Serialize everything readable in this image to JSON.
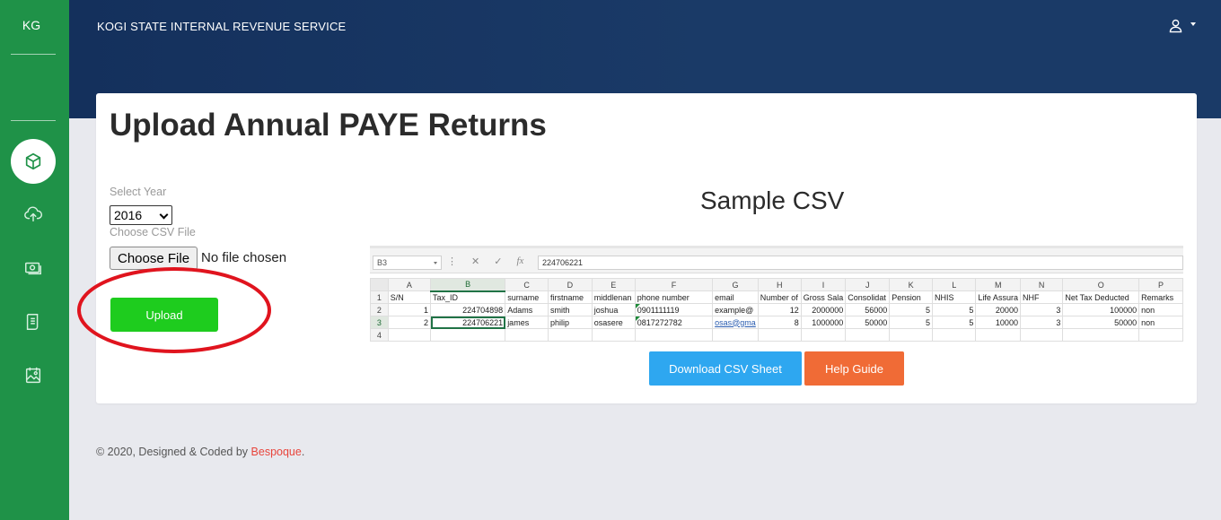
{
  "sidebar": {
    "brand": "KG",
    "items": [
      {
        "icon": "cube-icon",
        "active": true
      },
      {
        "icon": "cloud-upload-icon",
        "active": false
      },
      {
        "icon": "money-icon",
        "active": false
      },
      {
        "icon": "receipt-icon",
        "active": false
      },
      {
        "icon": "image-icon",
        "active": false
      }
    ]
  },
  "header": {
    "title": "KOGI STATE INTERNAL REVENUE SERVICE",
    "user_icon": "user-icon"
  },
  "main": {
    "page_title": "Upload Annual PAYE Returns",
    "select_year_label": "Select Year",
    "year_value": "2016",
    "csv_label": "Choose CSV File",
    "file_button": "Choose File",
    "file_status": "No file chosen",
    "upload_label": "Upload",
    "sample_title": "Sample CSV",
    "download_label": "Download CSV Sheet",
    "help_label": "Help Guide"
  },
  "sheet": {
    "name_box": "B3",
    "formula_value": "224706221",
    "columns": [
      "A",
      "B",
      "C",
      "D",
      "E",
      "F",
      "G",
      "H",
      "I",
      "J",
      "K",
      "L",
      "M",
      "N",
      "O",
      "P"
    ],
    "rows": [
      {
        "n": "1",
        "cells": [
          "S/N",
          "Tax_ID",
          "surname",
          "firstname",
          "middlenan",
          "phone number",
          "email",
          "Number of",
          "Gross  Sala",
          "Consolidat",
          "Pension",
          "NHIS",
          "Life Assura",
          "NHF",
          "Net Tax Deducted",
          "Remarks"
        ]
      },
      {
        "n": "2",
        "cells": [
          "1",
          "224704898",
          "Adams",
          "smith",
          "joshua",
          "0901111119",
          "example@",
          "12",
          "2000000",
          "56000",
          "5",
          "5",
          "20000",
          "3",
          "100000",
          "non"
        ]
      },
      {
        "n": "3",
        "cells": [
          "2",
          "224706221",
          "james",
          "philip",
          "osasere",
          "0817272782",
          "osas@gma",
          "8",
          "1000000",
          "50000",
          "5",
          "5",
          "10000",
          "3",
          "50000",
          "non"
        ]
      },
      {
        "n": "4",
        "cells": [
          "",
          "",
          "",
          "",
          "",
          "",
          "",
          "",
          "",
          "",
          "",
          "",
          "",
          "",
          "",
          ""
        ]
      }
    ]
  },
  "footer": {
    "text": "© 2020, Designed & Coded by ",
    "brand": "Bespoque",
    "suffix": "."
  },
  "colors": {
    "sidebar": "#1f9248",
    "header": "#1a3a67",
    "upload": "#1ecc1e",
    "download": "#2ea7f0",
    "help": "#f06b36",
    "annotation_ring": "#e0141e"
  }
}
